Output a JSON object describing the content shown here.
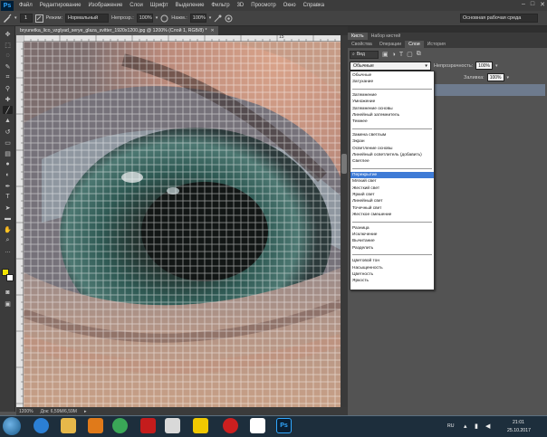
{
  "menubar": {
    "logo": "Ps",
    "items": [
      "Файл",
      "Редактирование",
      "Изображение",
      "Слои",
      "Шрифт",
      "Выделение",
      "Фильтр",
      "3D",
      "Просмотр",
      "Окно",
      "Справка"
    ],
    "window_controls": [
      "–",
      "□",
      "✕"
    ]
  },
  "optbar": {
    "brush_size": "1",
    "mode_label": "Режим:",
    "mode_value": "Нормальный",
    "opacity_label": "Непрозр.:",
    "opacity_value": "100%",
    "flow_label": "Нажм.:",
    "flow_value": "100%",
    "workspace": "Основная рабочая среда"
  },
  "document": {
    "tab_title": "bryunetka_lico_vzglyad_serye_glaza_svitter_1920x1200.jpg @ 1200% (Слой 1, RGB/8) *",
    "ruler_mark": "15"
  },
  "status": {
    "zoom": "1200%",
    "doc_info": "Док: 6,59M/6,59M"
  },
  "panel": {
    "top_tabs": [
      "Кисть",
      "Набор кистей"
    ],
    "tabs": [
      "Свойства",
      "Операции",
      "Слои",
      "История"
    ],
    "active_tab": "Слои",
    "kind_label": "Вид",
    "blend_mode": "Обычные",
    "opacity_label": "Непрозрачность:",
    "opacity_value": "100%",
    "fill_label": "Заливка:",
    "fill_value": "100%"
  },
  "blend_modes": [
    [
      "Обычные",
      "Затухание"
    ],
    [
      "Затемнение",
      "Умножение",
      "Затемнение основы",
      "Линейный затемнитель",
      "Темнее"
    ],
    [
      "Замена светлым",
      "Экран",
      "Осветление основы",
      "Линейный осветлитель (добавить)",
      "Светлее"
    ],
    [
      "Перекрытие",
      "Мягкий свет",
      "Жесткий свет",
      "Яркий свет",
      "Линейный свет",
      "Точечный свет",
      "Жесткое смешение"
    ],
    [
      "Разница",
      "Исключение",
      "Вычитание",
      "Разделить"
    ],
    [
      "Цветовой тон",
      "Насыщенность",
      "Цветность",
      "Яркость"
    ]
  ],
  "selected_blend_mode": "Перекрытие",
  "taskbar": {
    "apps": [
      "ie",
      "explorer",
      "wmp",
      "chrome",
      "dvd",
      "paint",
      "yandex",
      "opera",
      "yandex-y",
      "photoshop"
    ],
    "language": "RU",
    "time": "21:01",
    "date": "25.10.2017"
  },
  "colors": {
    "foreground": "#f2e400",
    "background": "#ffffff",
    "selection": "#3e7bd6"
  }
}
